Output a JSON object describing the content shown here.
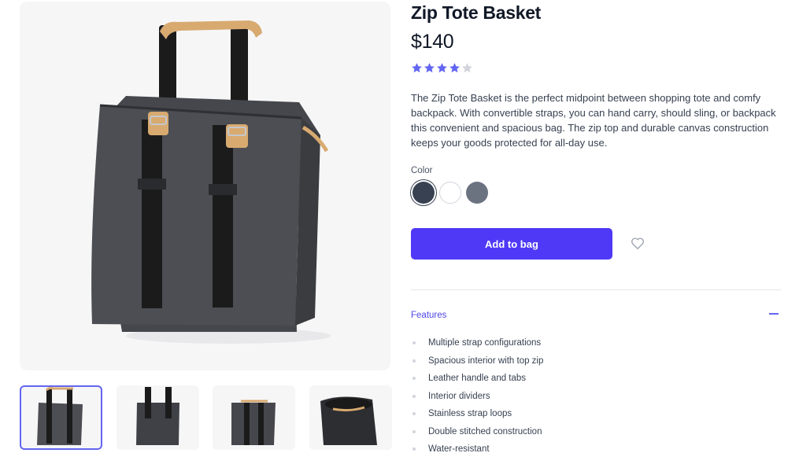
{
  "product": {
    "title": "Zip Tote Basket",
    "price": "$140",
    "rating": 4,
    "rating_max": 5,
    "description": "The Zip Tote Basket is the perfect midpoint between shopping tote and comfy backpack. With convertible straps, you can hand carry, should sling, or backpack this convenient and spacious bag. The zip top and durable canvas construction keeps your goods protected for all-day use."
  },
  "gallery": {
    "main_image": "zip-tote-basket-photo",
    "thumbnails": [
      {
        "name": "front-view",
        "selected": true
      },
      {
        "name": "back-view",
        "selected": false
      },
      {
        "name": "backpack-view",
        "selected": false
      },
      {
        "name": "open-top-view",
        "selected": false
      }
    ]
  },
  "colors": {
    "label": "Color",
    "options": [
      {
        "name": "washed-black",
        "hex": "#374151",
        "selected": true
      },
      {
        "name": "white",
        "hex": "#ffffff",
        "selected": false
      },
      {
        "name": "washed-gray",
        "hex": "#6b7280",
        "selected": false
      }
    ]
  },
  "actions": {
    "add_to_bag": "Add to bag",
    "favorite_icon": "heart-icon"
  },
  "features": {
    "heading": "Features",
    "toggle_icon": "minus-icon",
    "items": [
      "Multiple strap configurations",
      "Spacious interior with top zip",
      "Leather handle and tabs",
      "Interior dividers",
      "Stainless strap loops",
      "Double stitched construction",
      "Water-resistant"
    ]
  },
  "theme": {
    "accent": "#4f39f6",
    "star_filled": "#6366f1",
    "star_empty": "#d1d5db"
  }
}
